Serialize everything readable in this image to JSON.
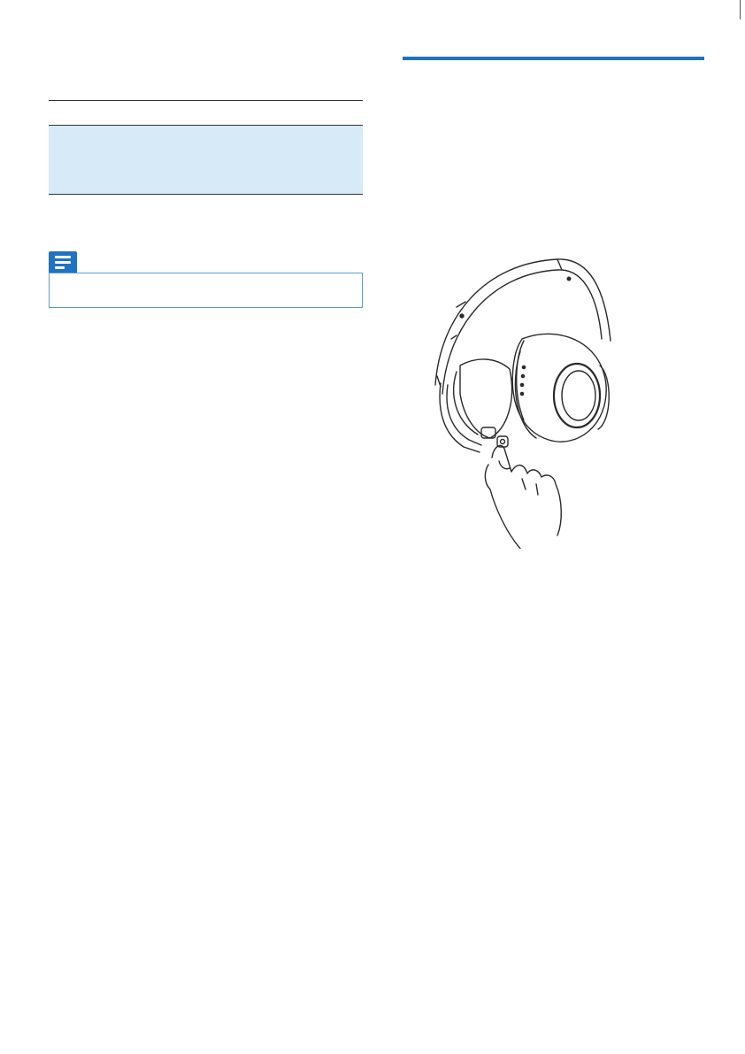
{
  "page": {
    "accent_color": "#1f72c4",
    "table_fill_color": "#d6eaf8",
    "note_border_color": "#5b9bd5"
  },
  "left_column": {
    "table": {
      "rows": []
    },
    "note": {
      "icon": "note-icon"
    }
  },
  "right_column": {
    "illustration": {
      "icon": "headphones-button-press-illustration"
    }
  }
}
